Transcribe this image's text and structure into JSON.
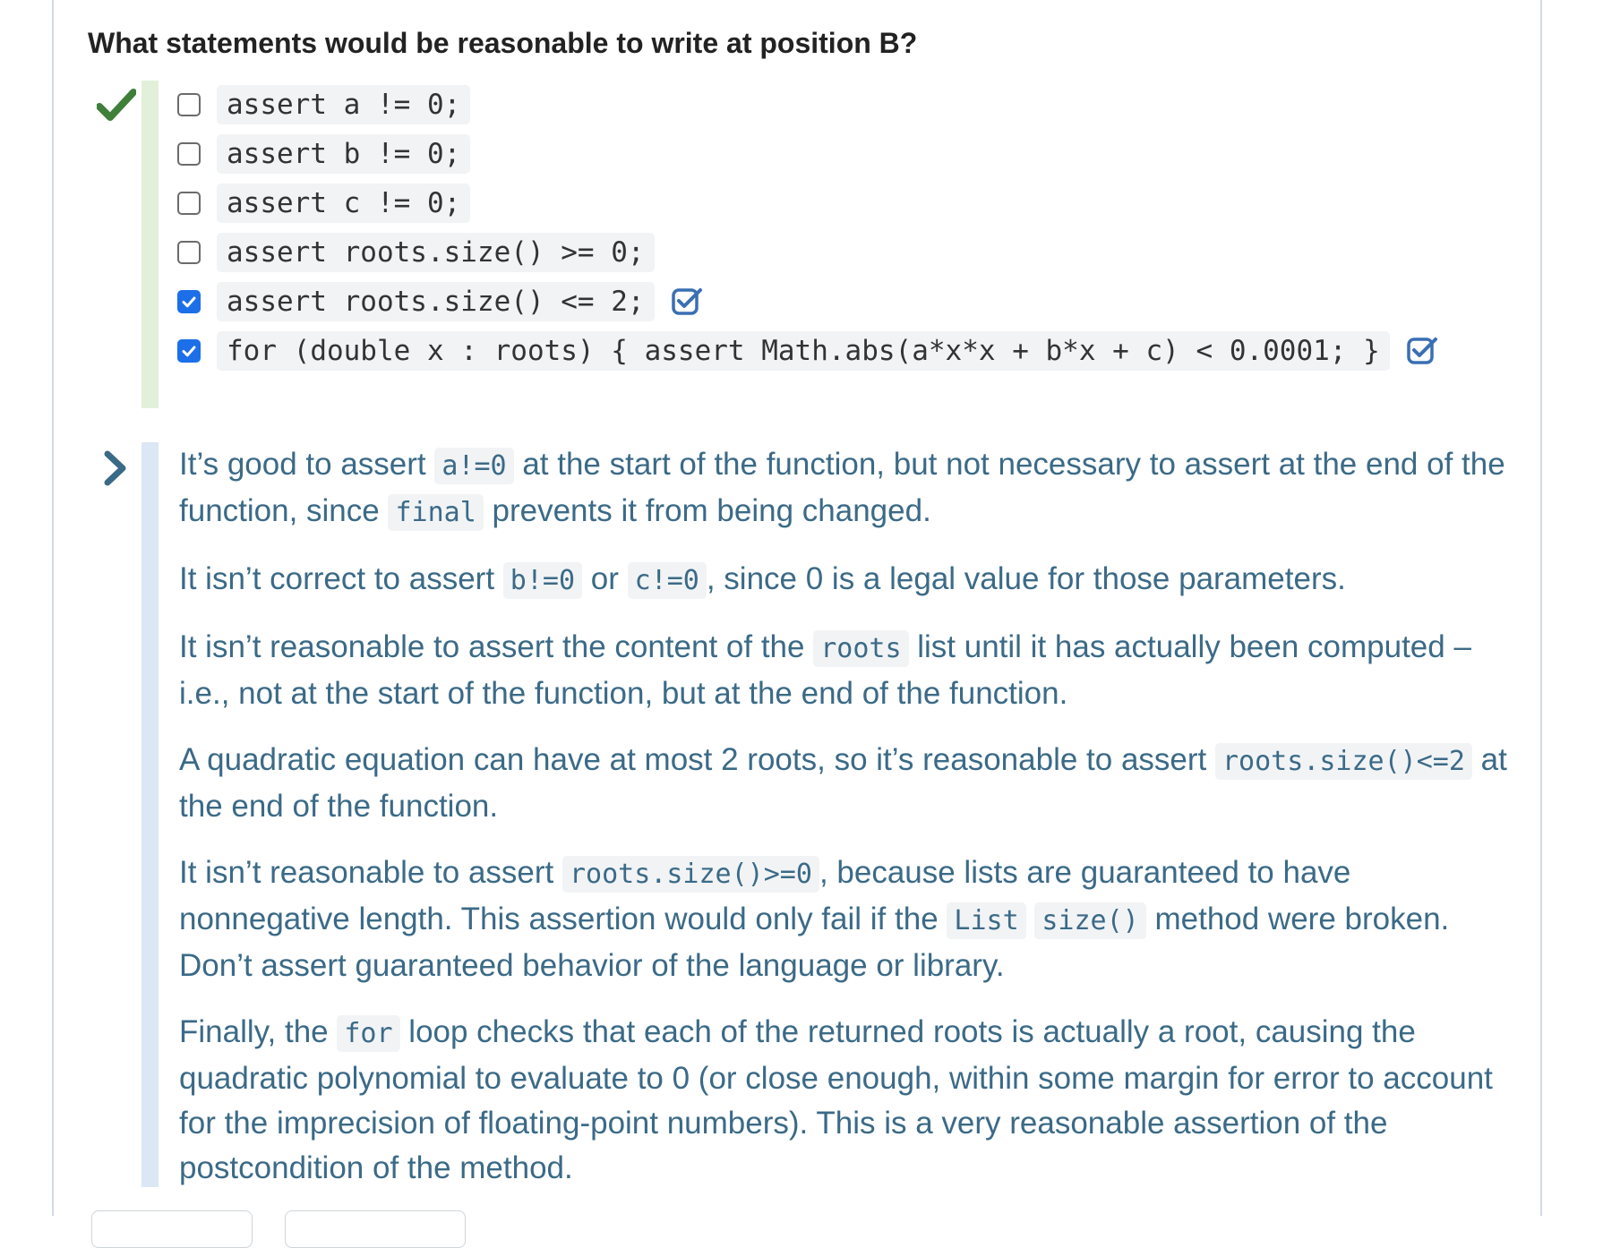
{
  "question": {
    "title": "What statements would be reasonable to write at position B?",
    "status": "correct"
  },
  "choices": [
    {
      "code": "assert a != 0;",
      "checked": false
    },
    {
      "code": "assert b != 0;",
      "checked": false
    },
    {
      "code": "assert c != 0;",
      "checked": false
    },
    {
      "code": "assert roots.size() >= 0;",
      "checked": false
    },
    {
      "code": "assert roots.size() <= 2;",
      "checked": true
    },
    {
      "code": "for (double x : roots) { assert Math.abs(a*x*x + b*x + c) < 0.0001; }",
      "checked": true
    }
  ],
  "feedback": {
    "p1": {
      "t1": "It’s good to assert ",
      "c1": "a!=0",
      "t2": " at the start of the function, but not necessary to assert at the end of the function, since ",
      "c2": "final",
      "t3": " prevents it from being changed."
    },
    "p2": {
      "t1": "It isn’t correct to assert ",
      "c1": "b!=0",
      "t2": " or ",
      "c2": "c!=0",
      "t3": ", since 0 is a legal value for those parameters."
    },
    "p3": {
      "t1": "It isn’t reasonable to assert the content of the ",
      "c1": "roots",
      "t2": " list until it has actually been computed – i.e., not at the start of the function, but at the end of the function."
    },
    "p4": {
      "t1": "A quadratic equation can have at most 2 roots, so it’s reasonable to assert ",
      "c1": "roots.size()<=2",
      "t2": " at the end of the function."
    },
    "p5": {
      "t1": "It isn’t reasonable to assert ",
      "c1": "roots.size()>=0",
      "t2": ", because lists are guaranteed to have nonnegative length. This assertion would only fail if the ",
      "c2": "List",
      "t3": " ",
      "c3": "size()",
      "t4": " method were broken. Don’t assert guaranteed behavior of the language or library."
    },
    "p6": {
      "t1": "Finally, the ",
      "c1": "for",
      "t2": " loop checks that each of the returned roots is actually a root, causing the quadratic polynomial to evaluate to 0 (or close enough, within some margin for error to account for the imprecision of floating-point numbers). This is a very reasonable assertion of the postcondition of the method."
    }
  },
  "colors": {
    "correct_green": "#3f7f3a",
    "checkbox_blue": "#1c6fe8",
    "feedback_text": "#3b6a87",
    "choices_bar": "#e2f0da",
    "feedback_bar": "#dbe7f4"
  },
  "icons": {
    "correct": "checkmark-icon",
    "verified": "checkbox-verified-icon",
    "feedback": "chevron-right-icon"
  }
}
